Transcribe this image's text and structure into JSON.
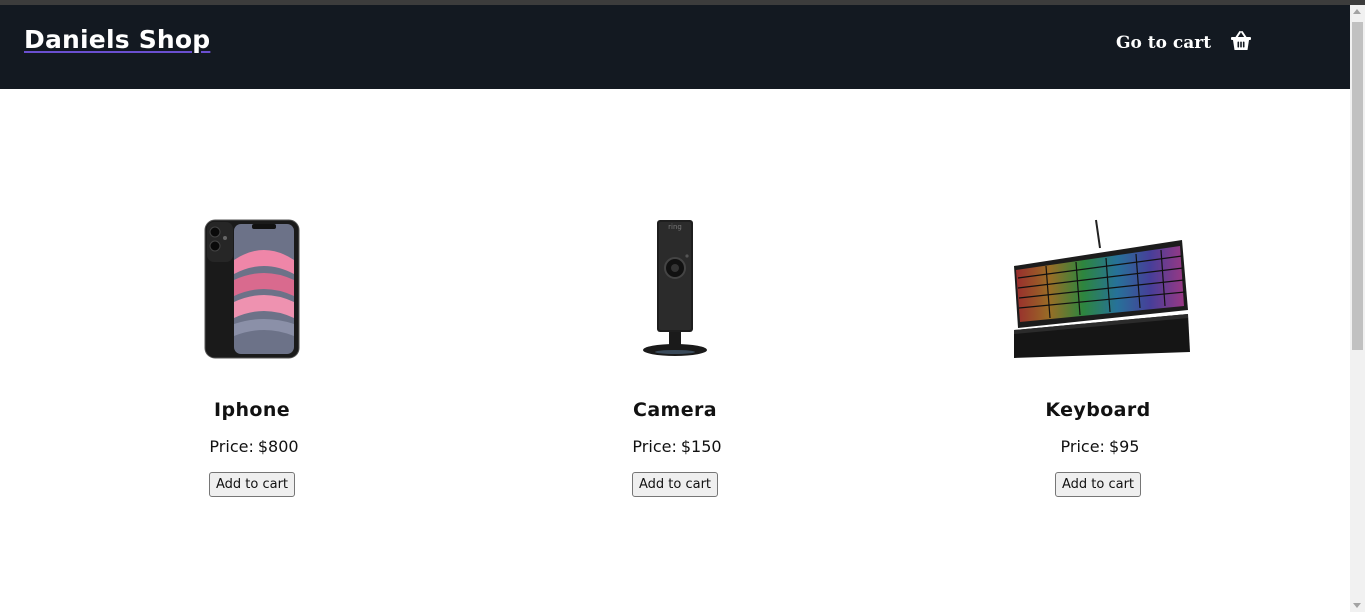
{
  "header": {
    "brand": "Daniels Shop",
    "go_to_cart": "Go to cart",
    "cart_icon": "basket-icon",
    "background": "#131921"
  },
  "products": [
    {
      "name": "Iphone",
      "price_label": "Price:",
      "price": "$800",
      "button": "Add to cart",
      "image": "smartphone-image"
    },
    {
      "name": "Camera",
      "price_label": "Price:",
      "price": "$150",
      "button": "Add to cart",
      "image": "security-camera-image"
    },
    {
      "name": "Keyboard",
      "price_label": "Price:",
      "price": "$95",
      "button": "Add to cart",
      "image": "rgb-keyboard-image"
    }
  ]
}
